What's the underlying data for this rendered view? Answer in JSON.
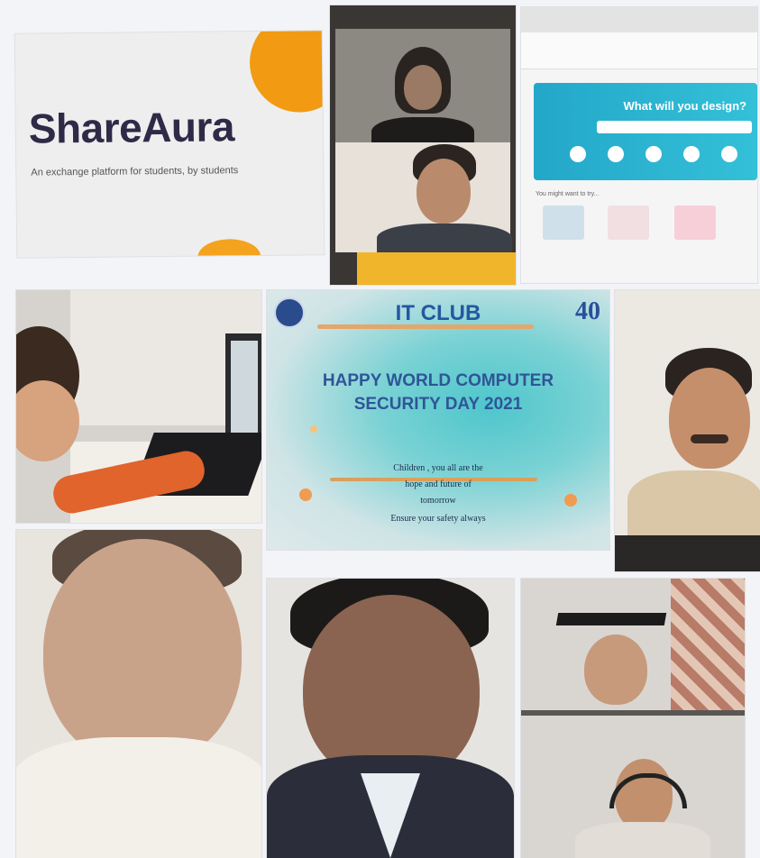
{
  "collage": {
    "slide_shareaura": {
      "brand": "ShareAura",
      "tagline": "An exchange platform for students, by students"
    },
    "slide_canva": {
      "hero_title": "What will you design?",
      "section_label": "You might want to try..."
    },
    "slide_it_club": {
      "club_title": "IT CLUB",
      "anniversary": "40",
      "headline_line1": "HAPPY WORLD COMPUTER",
      "headline_line2": "SECURITY DAY 2021",
      "message_line1": "Children , you all are the",
      "message_line2": "hope and future of",
      "message_line3": "tomorrow",
      "message_line4": "Ensure your safety always"
    }
  },
  "colors": {
    "brand_orange": "#f19a12",
    "brand_navy": "#2e2a47",
    "canva_teal": "#23a7c9",
    "slide_blue": "#2f5597"
  }
}
